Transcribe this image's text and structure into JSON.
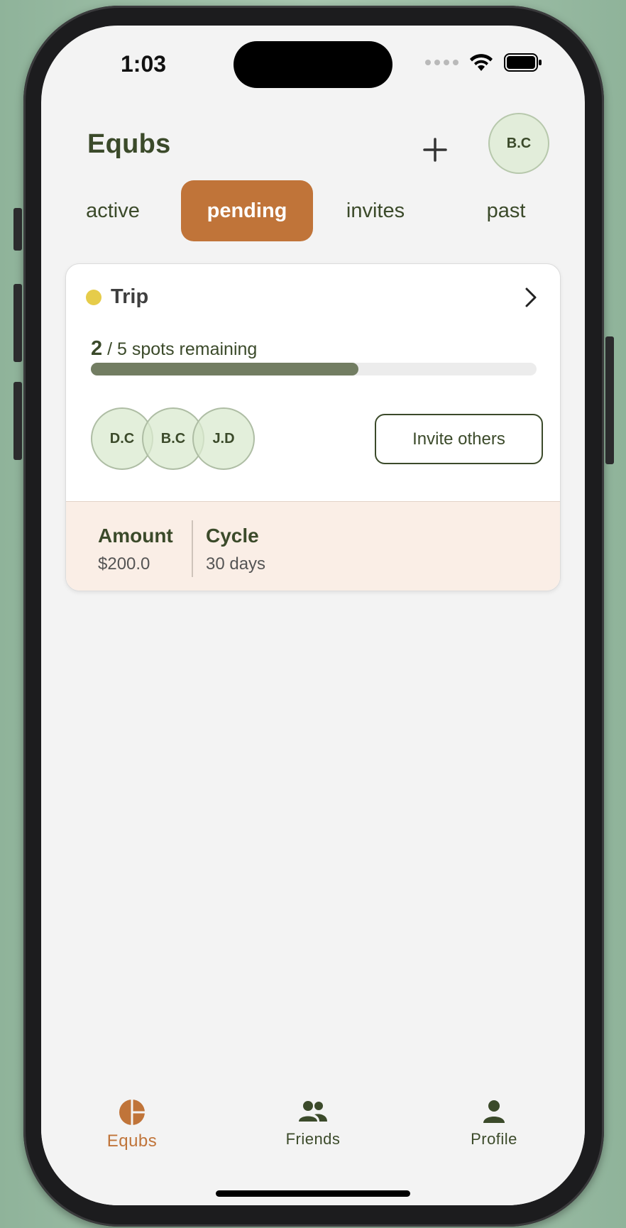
{
  "status_bar": {
    "time": "1:03"
  },
  "header": {
    "title": "Equbs",
    "add_icon": "plus-icon",
    "user_initials": "B.C"
  },
  "tabs": [
    {
      "label": "active",
      "selected": false
    },
    {
      "label": "pending",
      "selected": true
    },
    {
      "label": "invites",
      "selected": false
    },
    {
      "label": "past",
      "selected": false
    }
  ],
  "equb_card": {
    "title": "Trip",
    "status_color": "#e6cc4a",
    "spots_remaining": "2",
    "spots_total_text": "/ 5 spots remaining",
    "progress_fraction": 0.6,
    "members": [
      "D.C",
      "B.C",
      "J.D"
    ],
    "invite_label": "Invite others",
    "amount_label": "Amount",
    "amount_value": "$200.0",
    "cycle_label": "Cycle",
    "cycle_value": "30 days"
  },
  "bottom_nav": [
    {
      "label": "Equbs",
      "icon": "pie-chart-icon",
      "current": true
    },
    {
      "label": "Friends",
      "icon": "people-icon",
      "current": false
    },
    {
      "label": "Profile",
      "icon": "person-icon",
      "current": false
    }
  ],
  "colors": {
    "accent": "#c07439",
    "primary_text": "#3b4a2a",
    "progress": "#727d62"
  }
}
